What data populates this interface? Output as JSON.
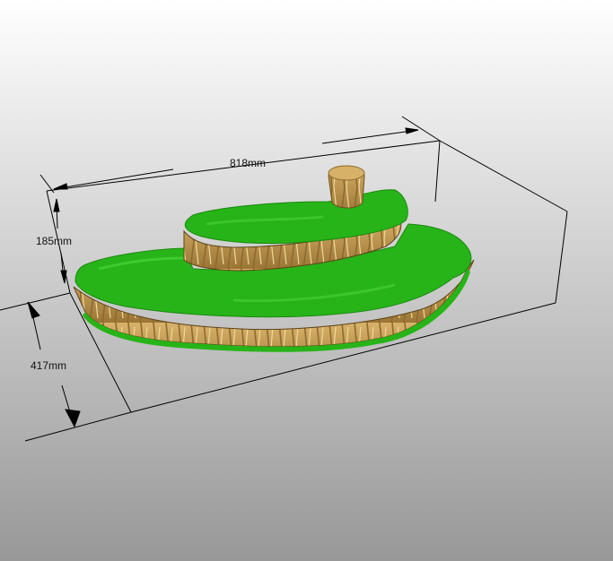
{
  "viewport": {
    "background_top_color": "#ffffff",
    "background_bottom_color": "#989898",
    "bounding_box_color": "#000000"
  },
  "dimensions": {
    "width_label": "818mm",
    "height_label": "185mm",
    "depth_label": "417mm"
  },
  "model": {
    "grass_color": "#27b418",
    "grass_highlight_color": "#49d43a",
    "rock_color": "#d9b36a",
    "rock_shadow_color": "#9a7535",
    "stump_color": "#d6b167"
  }
}
